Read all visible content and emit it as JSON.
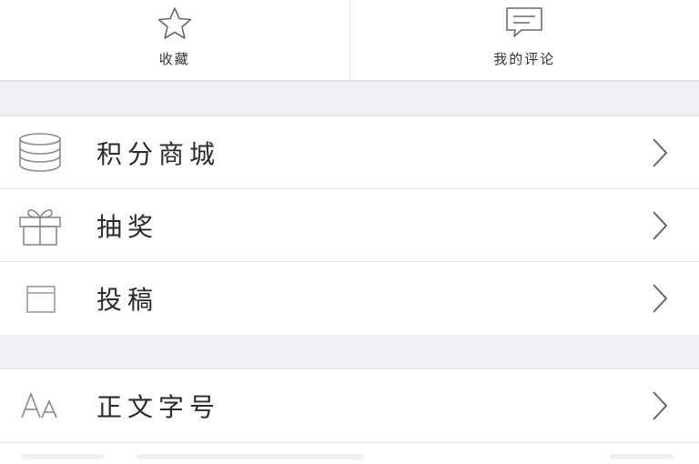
{
  "top_actions": [
    {
      "label": "收藏",
      "icon": "star-icon"
    },
    {
      "label": "我的评论",
      "icon": "comment-icon"
    }
  ],
  "group1": [
    {
      "label": "积分商城",
      "icon": "database-icon"
    },
    {
      "label": "抽奖",
      "icon": "gift-icon"
    },
    {
      "label": "投稿",
      "icon": "window-icon"
    }
  ],
  "group2": [
    {
      "label": "正文字号",
      "icon": "font-size-icon"
    }
  ]
}
